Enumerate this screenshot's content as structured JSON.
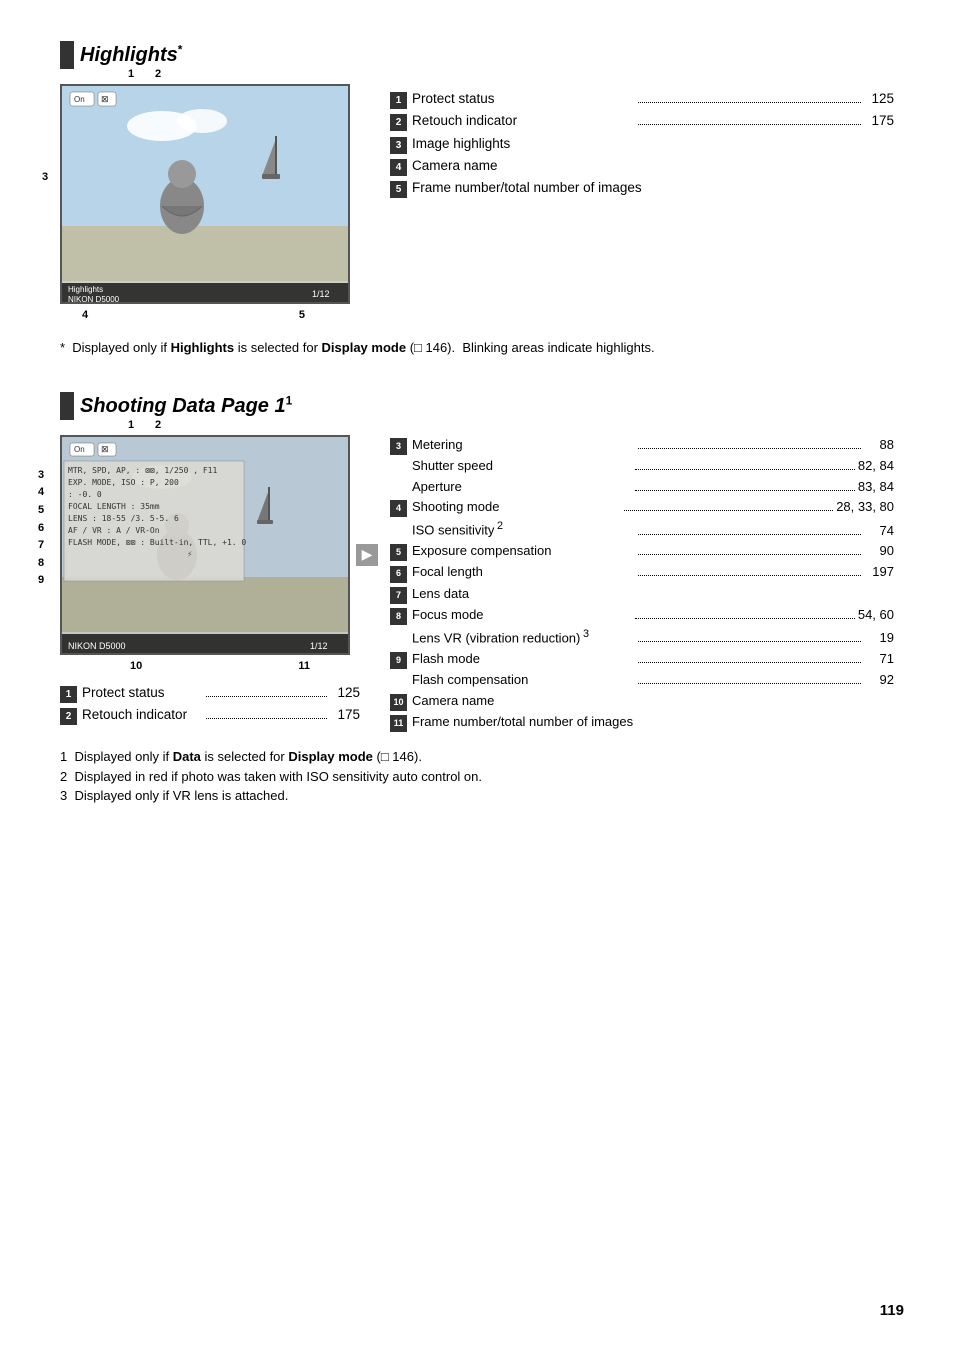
{
  "page_number": "119",
  "highlights_section": {
    "heading": "Highlights",
    "heading_super": "*",
    "items": [
      {
        "badge": "1",
        "text": "Protect status",
        "dots": true,
        "page": "125"
      },
      {
        "badge": "2",
        "text": "Retouch indicator",
        "dots": true,
        "page": "175"
      },
      {
        "badge": "3",
        "text": "Image highlights",
        "dots": false,
        "page": ""
      },
      {
        "badge": "4",
        "text": "Camera name",
        "dots": false,
        "page": ""
      },
      {
        "badge": "5",
        "text": "Frame number/total number of images",
        "dots": false,
        "page": ""
      }
    ],
    "footnote": "* Displayed only if <b>Highlights</b> is selected for <b>Display mode</b> (&#9633; 146).  Blinking areas indicate highlights.",
    "lcd": {
      "top_icons": [
        "On",
        "⊠"
      ],
      "label_1": "1",
      "label_2": "2",
      "label_3": "3",
      "label_4": "4",
      "label_5": "5",
      "bottom_left": "Highlights\nNIKON D5000",
      "bottom_right": "1/12"
    }
  },
  "shooting_data_section": {
    "heading": "Shooting Data Page 1",
    "heading_super": "1",
    "lcd": {
      "top_icons": [
        "On",
        "⊠"
      ],
      "rows": [
        {
          "label": "MTR, SPD, AP,",
          "value": "⊠⊠, 1/250  , F11"
        },
        {
          "label": "EXP. MODE, ISO",
          "value": "P, 200"
        },
        {
          "label": "",
          "value": "-0. 0"
        },
        {
          "label": "FOCAL LENGTH",
          "value": "35mm"
        },
        {
          "label": "LENS",
          "value": "18-55  /3. 5-5. 6"
        },
        {
          "label": "AF / VR",
          "value": "A /  VR-On"
        },
        {
          "label": "FLASH MODE, ⊠⊠",
          "value": "Built-in, TTL, +1. 0"
        }
      ],
      "bottom_left": "NIKON D5000",
      "bottom_right": "1/12",
      "label_10": "10",
      "label_11": "11"
    },
    "left_items": [
      {
        "badge": "1",
        "text": "Protect status",
        "dots": true,
        "page": "125"
      },
      {
        "badge": "2",
        "text": "Retouch indicator",
        "dots": true,
        "page": "175"
      }
    ],
    "right_items": [
      {
        "badge": "3",
        "text": "Metering",
        "dots": true,
        "page": "88",
        "sub": []
      },
      {
        "badge": "",
        "text": "Shutter speed",
        "dots": true,
        "page": "82, 84",
        "sub": true
      },
      {
        "badge": "",
        "text": "Aperture",
        "dots": true,
        "page": "83, 84",
        "sub": true
      },
      {
        "badge": "4",
        "text": "Shooting mode",
        "dots": true,
        "page": "28, 33, 80",
        "sub": []
      },
      {
        "badge": "",
        "text": "ISO sensitivity ²",
        "dots": true,
        "page": "74",
        "sub": true
      },
      {
        "badge": "5",
        "text": "Exposure compensation",
        "dots": true,
        "page": "90",
        "sub": []
      },
      {
        "badge": "6",
        "text": "Focal length",
        "dots": true,
        "page": "197",
        "sub": []
      },
      {
        "badge": "7",
        "text": "Lens data",
        "dots": false,
        "page": "",
        "sub": []
      },
      {
        "badge": "8",
        "text": "Focus mode",
        "dots": true,
        "page": "54, 60",
        "sub": []
      },
      {
        "badge": "",
        "text": "Lens VR (vibration reduction) ³",
        "dots": true,
        "page": "19",
        "sub": true
      },
      {
        "badge": "9",
        "text": "Flash mode",
        "dots": true,
        "page": "71",
        "sub": []
      },
      {
        "badge": "",
        "text": "Flash compensation",
        "dots": true,
        "page": "92",
        "sub": true
      },
      {
        "badge": "10",
        "text": "Camera name",
        "dots": false,
        "page": "",
        "sub": []
      },
      {
        "badge": "11",
        "text": "Frame number/total number of images",
        "dots": false,
        "page": "",
        "sub": []
      }
    ],
    "footnotes": [
      "1   Displayed only if <b>Data</b> is selected for <b>Display mode</b> (&#9633; 146).",
      "2   Displayed in red if photo was taken with ISO sensitivity auto control on.",
      "3   Displayed only if VR lens is attached."
    ]
  }
}
